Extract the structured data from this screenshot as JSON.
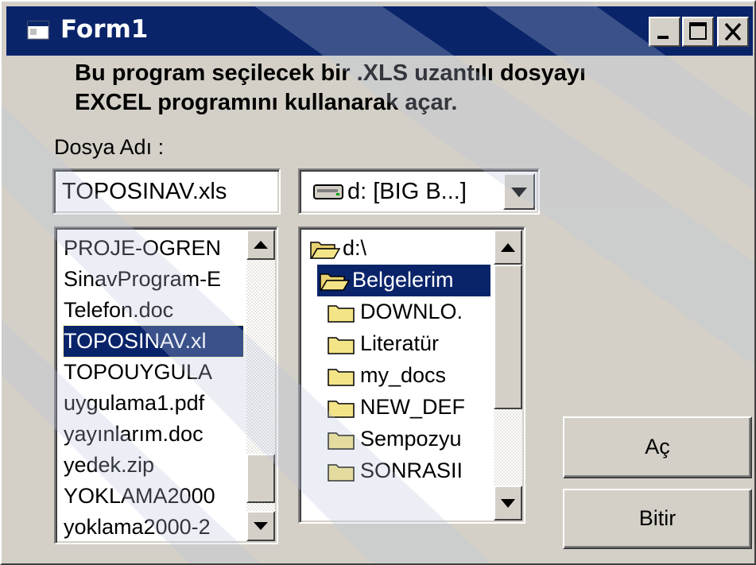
{
  "window": {
    "title": "Form1",
    "controls": {
      "minimize": "minimize",
      "maximize": "maximize",
      "close": "close"
    }
  },
  "info": {
    "line1": "Bu program seçilecek bir .XLS uzantılı dosyayı",
    "line2": "EXCEL programını kullanarak açar."
  },
  "file_label": "Dosya Adı :",
  "filename_value": "TOPOSINAV.xls",
  "drive": {
    "selected": "d: [BIG B...]"
  },
  "file_list": {
    "items": [
      "PROJE-OGREN",
      "SinavProgram-E",
      "Telefon.doc",
      "TOPOSINAV.xl",
      "TOPOUYGULA",
      "uygulama1.pdf",
      "yayınlarım.doc",
      "yedek.zip",
      "YOKLAMA2000",
      "yoklama2000-2"
    ],
    "selected_index": 3
  },
  "dir_list": {
    "items": [
      {
        "name": "d:\\",
        "open": true,
        "level": 0
      },
      {
        "name": "Belgelerim",
        "open": true,
        "level": 1
      },
      {
        "name": "DOWNLO.",
        "open": false,
        "level": 2
      },
      {
        "name": "Literatür",
        "open": false,
        "level": 2
      },
      {
        "name": "my_docs",
        "open": false,
        "level": 2
      },
      {
        "name": "NEW_DEF",
        "open": false,
        "level": 2
      },
      {
        "name": "Sempozyu",
        "open": false,
        "level": 2
      },
      {
        "name": "SONRASII",
        "open": false,
        "level": 2
      }
    ],
    "selected_index": 1
  },
  "buttons": {
    "open_label": "Aç",
    "exit_label": "Bitir"
  },
  "colors": {
    "face": "#d4d0c8",
    "title": "#0a246a",
    "selection": "#0a246a",
    "folder": "#f4e488"
  }
}
